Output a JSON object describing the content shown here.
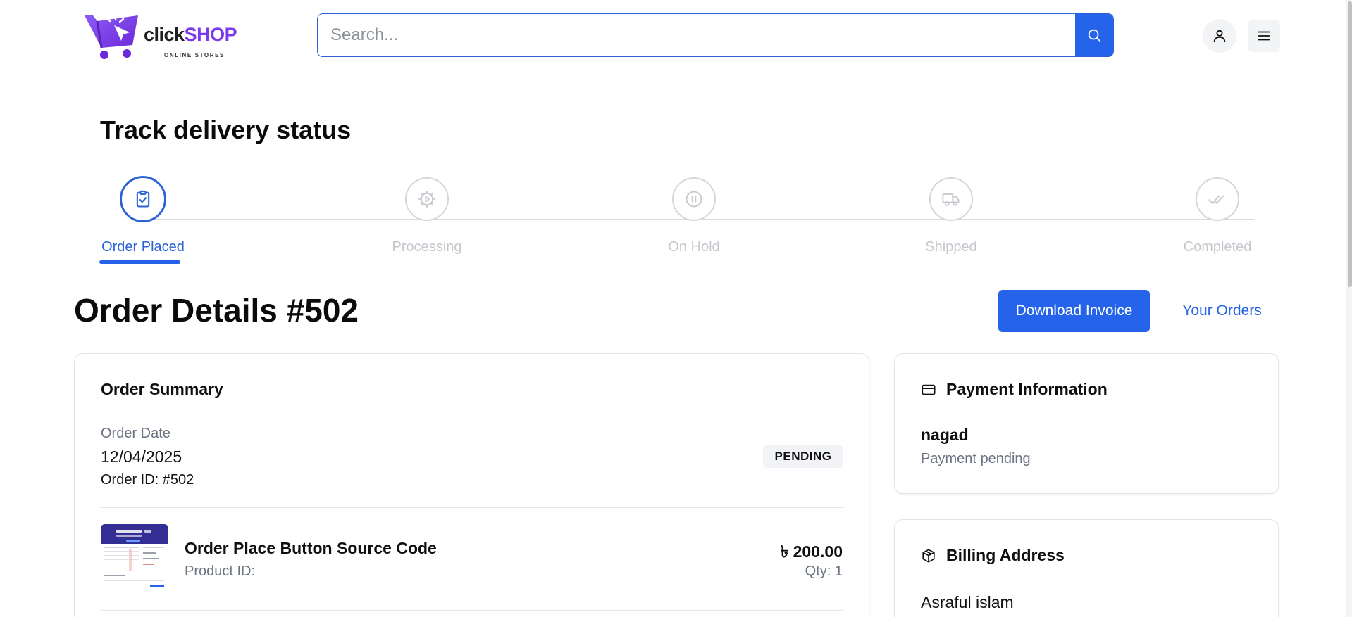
{
  "header": {
    "logo": {
      "word_part1": "click",
      "word_part2": "SHOP",
      "subtitle": "ONLINE STORES"
    },
    "search": {
      "placeholder": "Search...",
      "value": ""
    },
    "icons": {
      "search": "search-icon",
      "user": "user-icon",
      "menu": "hamburger-menu-icon"
    }
  },
  "tracker": {
    "title": "Track delivery status",
    "steps": [
      {
        "label": "Order Placed",
        "icon": "clipboard-check-icon",
        "active": true
      },
      {
        "label": "Processing",
        "icon": "gear-play-icon",
        "active": false
      },
      {
        "label": "On Hold",
        "icon": "pause-icon",
        "active": false
      },
      {
        "label": "Shipped",
        "icon": "truck-icon",
        "active": false
      },
      {
        "label": "Completed",
        "icon": "double-check-icon",
        "active": false
      }
    ]
  },
  "order": {
    "title": "Order Details #502",
    "download_invoice_label": "Download Invoice",
    "your_orders_label": "Your Orders"
  },
  "summary": {
    "title": "Order Summary",
    "order_date_label": "Order Date",
    "order_date": "12/04/2025",
    "order_id": "Order ID: #502",
    "status": "PENDING",
    "items": [
      {
        "name": "Order Place Button Source Code",
        "product_id": "Product ID:",
        "price": "৳ 200.00",
        "qty": "Qty: 1"
      }
    ]
  },
  "payment": {
    "title": "Payment Information",
    "method": "nagad",
    "status": "Payment pending"
  },
  "billing": {
    "title": "Billing Address",
    "name": "Asraful islam"
  },
  "colors": {
    "accent": "#2563eb",
    "brand_purple": "#7c3aed",
    "muted_text": "#6b7280",
    "inactive_step": "#c4c7cc"
  }
}
